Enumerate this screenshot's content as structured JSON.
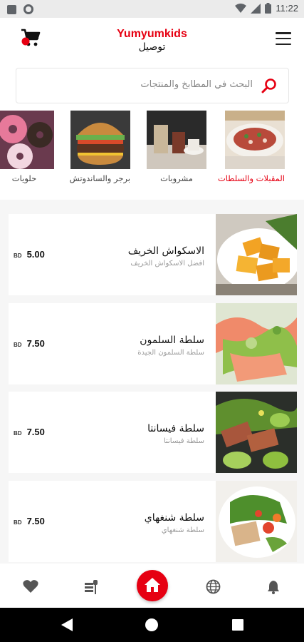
{
  "status_bar": {
    "time": "11:22"
  },
  "header": {
    "brand": "Yumyumkids",
    "subtitle": "توصيل"
  },
  "search": {
    "placeholder": "البحث في المطابخ والمنتجات"
  },
  "categories": [
    {
      "label": "المقبلات والسلطات",
      "active": true
    },
    {
      "label": "مشروبات",
      "active": false
    },
    {
      "label": "برجر والساندوتش",
      "active": false
    },
    {
      "label": "حلويات",
      "active": false
    }
  ],
  "products": [
    {
      "name": "الاسكواش الخريف",
      "desc": "افضل الاسكواش الخريف",
      "currency": "BD",
      "price": "5.00"
    },
    {
      "name": "سلطة السلمون",
      "desc": "سلطة السلمون الجيدة",
      "currency": "BD",
      "price": "7.50"
    },
    {
      "name": "سلطة فيسانتا",
      "desc": "سلطة فيسانتا",
      "currency": "BD",
      "price": "7.50"
    },
    {
      "name": "سلطة شنغهاي",
      "desc": "سلطة شنغهاي",
      "currency": "BD",
      "price": "7.50"
    }
  ],
  "bottom_nav": [
    "heart-icon",
    "menu-food-icon",
    "home-icon",
    "globe-icon",
    "bell-icon"
  ],
  "colors": {
    "brand": "#e60012",
    "text": "#111111",
    "muted": "#9a9a9a"
  }
}
